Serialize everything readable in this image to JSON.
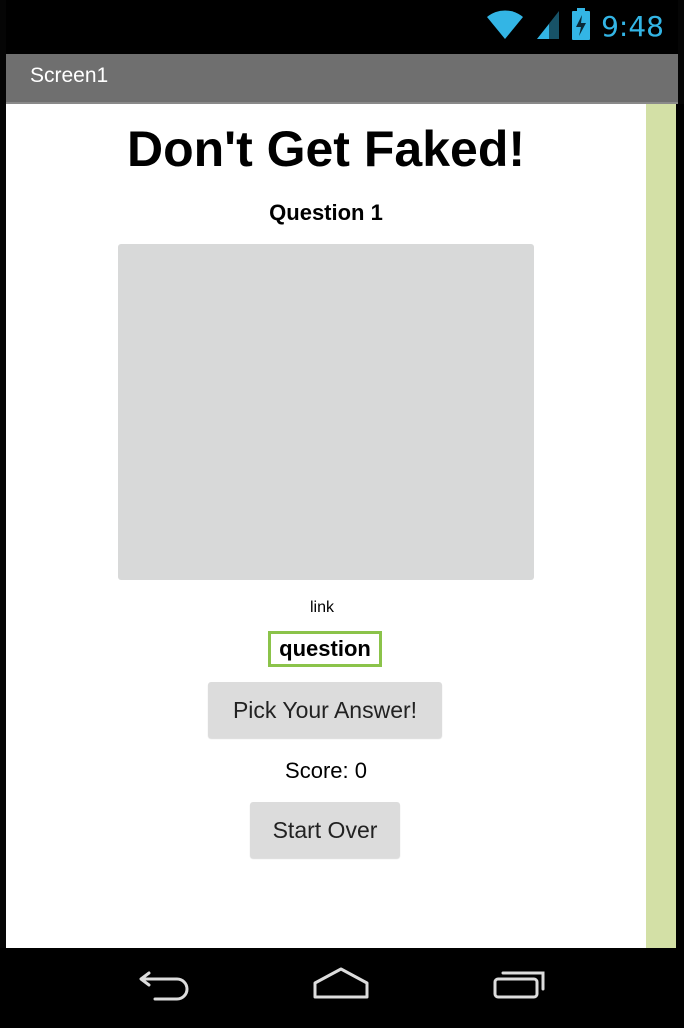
{
  "status_bar": {
    "time": "9:48",
    "icons": [
      "wifi-icon",
      "signal-icon",
      "battery-charging-icon"
    ],
    "accent_color": "#33b5e5"
  },
  "title_bar": {
    "title": "Screen1",
    "background": "#6f6f6f"
  },
  "screen": {
    "heading": "Don't Get Faked!",
    "question_label": "Question 1",
    "image_placeholder_color": "#d8d9d9",
    "link_label": "link",
    "question_text": "question",
    "question_border_color": "#8bc34a",
    "pick_button_label": "Pick Your Answer!",
    "score_label": "Score: 0",
    "start_over_label": "Start Over",
    "side_strip_color": "#d3e0a6"
  },
  "nav_bar": {
    "buttons": [
      "back-icon",
      "home-icon",
      "recent-apps-icon"
    ]
  }
}
